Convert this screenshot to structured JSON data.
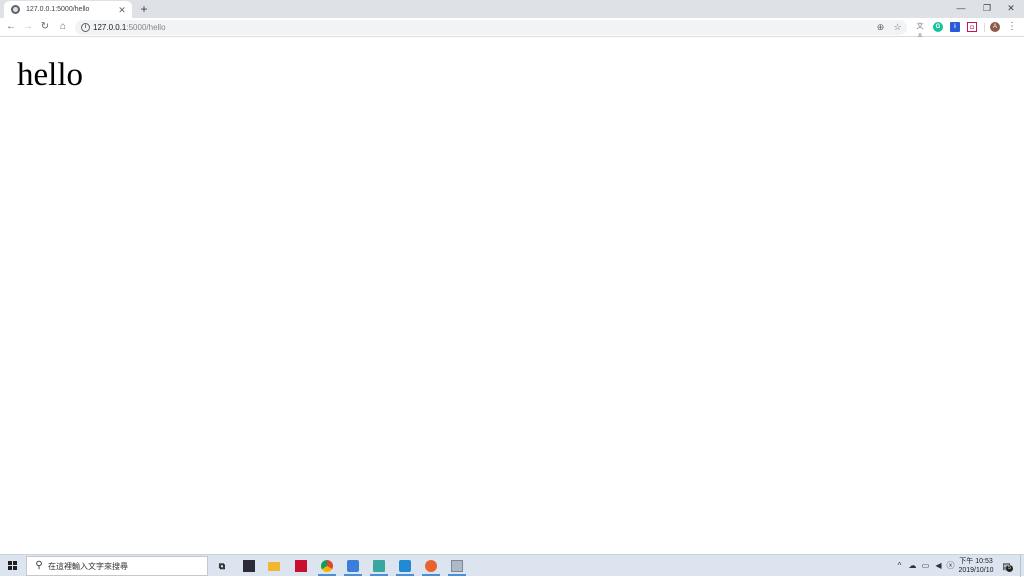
{
  "browser": {
    "tab": {
      "title": "127.0.0.1:5000/hello",
      "favicon_icon": "globe-icon",
      "close_glyph": "✕"
    },
    "new_tab_glyph": "+",
    "window_controls": {
      "minimize_glyph": "—",
      "restore_glyph": "❐",
      "close_glyph": "✕"
    },
    "toolbar": {
      "back_glyph": "←",
      "forward_glyph": "→",
      "reload_glyph": "↻",
      "home_glyph": "⌂",
      "url_host": "127.0.0.1",
      "url_path": ":5000/hello",
      "info_glyph": "i",
      "zoom_glyph": "⊕",
      "bookmark_glyph": "☆",
      "extensions": [
        {
          "name": "translate-extension-icon",
          "glyph": "文A"
        },
        {
          "name": "grammarly-extension-icon",
          "glyph": "G"
        },
        {
          "name": "info-extension-icon",
          "glyph": "i"
        },
        {
          "name": "picture-extension-icon",
          "glyph": "◘"
        }
      ],
      "profile_initial": "A",
      "menu_glyph": "⋮"
    }
  },
  "page": {
    "heading": "hello"
  },
  "taskbar": {
    "search_placeholder": "在這裡輸入文字來搜尋",
    "search_glyph": "⚲",
    "clock": {
      "time": "下午 10:53",
      "date": "2019/10/10"
    },
    "notification_count": "5",
    "tray_expand_glyph": "^"
  },
  "colors": {
    "tab_strip": "#dee1e6",
    "omnibox": "#f1f3f4",
    "taskbar": "#dce4ef",
    "taskbar_active_indicator": "#4a90d9"
  }
}
